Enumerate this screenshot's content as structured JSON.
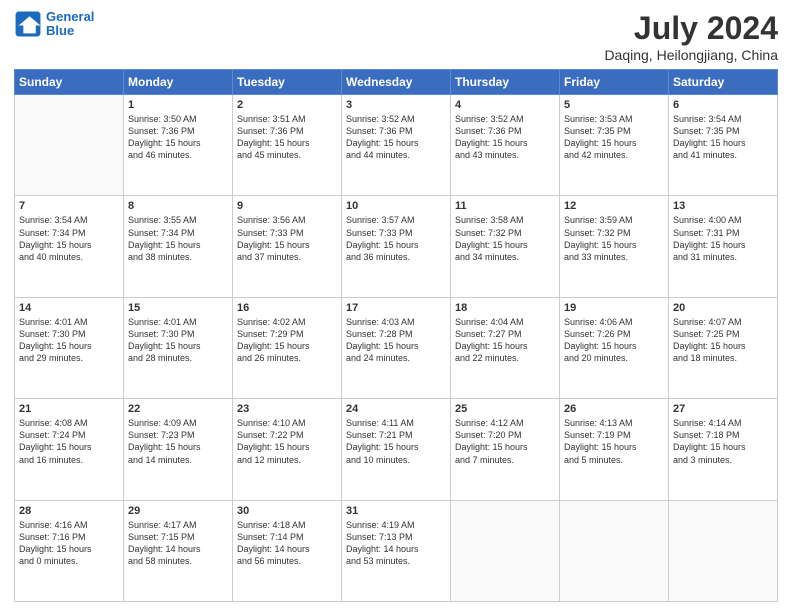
{
  "header": {
    "logo_line1": "General",
    "logo_line2": "Blue",
    "title": "July 2024",
    "subtitle": "Daqing, Heilongjiang, China"
  },
  "calendar": {
    "headers": [
      "Sunday",
      "Monday",
      "Tuesday",
      "Wednesday",
      "Thursday",
      "Friday",
      "Saturday"
    ],
    "rows": [
      [
        {
          "day": "",
          "info": ""
        },
        {
          "day": "1",
          "info": "Sunrise: 3:50 AM\nSunset: 7:36 PM\nDaylight: 15 hours\nand 46 minutes."
        },
        {
          "day": "2",
          "info": "Sunrise: 3:51 AM\nSunset: 7:36 PM\nDaylight: 15 hours\nand 45 minutes."
        },
        {
          "day": "3",
          "info": "Sunrise: 3:52 AM\nSunset: 7:36 PM\nDaylight: 15 hours\nand 44 minutes."
        },
        {
          "day": "4",
          "info": "Sunrise: 3:52 AM\nSunset: 7:36 PM\nDaylight: 15 hours\nand 43 minutes."
        },
        {
          "day": "5",
          "info": "Sunrise: 3:53 AM\nSunset: 7:35 PM\nDaylight: 15 hours\nand 42 minutes."
        },
        {
          "day": "6",
          "info": "Sunrise: 3:54 AM\nSunset: 7:35 PM\nDaylight: 15 hours\nand 41 minutes."
        }
      ],
      [
        {
          "day": "7",
          "info": "Sunrise: 3:54 AM\nSunset: 7:34 PM\nDaylight: 15 hours\nand 40 minutes."
        },
        {
          "day": "8",
          "info": "Sunrise: 3:55 AM\nSunset: 7:34 PM\nDaylight: 15 hours\nand 38 minutes."
        },
        {
          "day": "9",
          "info": "Sunrise: 3:56 AM\nSunset: 7:33 PM\nDaylight: 15 hours\nand 37 minutes."
        },
        {
          "day": "10",
          "info": "Sunrise: 3:57 AM\nSunset: 7:33 PM\nDaylight: 15 hours\nand 36 minutes."
        },
        {
          "day": "11",
          "info": "Sunrise: 3:58 AM\nSunset: 7:32 PM\nDaylight: 15 hours\nand 34 minutes."
        },
        {
          "day": "12",
          "info": "Sunrise: 3:59 AM\nSunset: 7:32 PM\nDaylight: 15 hours\nand 33 minutes."
        },
        {
          "day": "13",
          "info": "Sunrise: 4:00 AM\nSunset: 7:31 PM\nDaylight: 15 hours\nand 31 minutes."
        }
      ],
      [
        {
          "day": "14",
          "info": "Sunrise: 4:01 AM\nSunset: 7:30 PM\nDaylight: 15 hours\nand 29 minutes."
        },
        {
          "day": "15",
          "info": "Sunrise: 4:01 AM\nSunset: 7:30 PM\nDaylight: 15 hours\nand 28 minutes."
        },
        {
          "day": "16",
          "info": "Sunrise: 4:02 AM\nSunset: 7:29 PM\nDaylight: 15 hours\nand 26 minutes."
        },
        {
          "day": "17",
          "info": "Sunrise: 4:03 AM\nSunset: 7:28 PM\nDaylight: 15 hours\nand 24 minutes."
        },
        {
          "day": "18",
          "info": "Sunrise: 4:04 AM\nSunset: 7:27 PM\nDaylight: 15 hours\nand 22 minutes."
        },
        {
          "day": "19",
          "info": "Sunrise: 4:06 AM\nSunset: 7:26 PM\nDaylight: 15 hours\nand 20 minutes."
        },
        {
          "day": "20",
          "info": "Sunrise: 4:07 AM\nSunset: 7:25 PM\nDaylight: 15 hours\nand 18 minutes."
        }
      ],
      [
        {
          "day": "21",
          "info": "Sunrise: 4:08 AM\nSunset: 7:24 PM\nDaylight: 15 hours\nand 16 minutes."
        },
        {
          "day": "22",
          "info": "Sunrise: 4:09 AM\nSunset: 7:23 PM\nDaylight: 15 hours\nand 14 minutes."
        },
        {
          "day": "23",
          "info": "Sunrise: 4:10 AM\nSunset: 7:22 PM\nDaylight: 15 hours\nand 12 minutes."
        },
        {
          "day": "24",
          "info": "Sunrise: 4:11 AM\nSunset: 7:21 PM\nDaylight: 15 hours\nand 10 minutes."
        },
        {
          "day": "25",
          "info": "Sunrise: 4:12 AM\nSunset: 7:20 PM\nDaylight: 15 hours\nand 7 minutes."
        },
        {
          "day": "26",
          "info": "Sunrise: 4:13 AM\nSunset: 7:19 PM\nDaylight: 15 hours\nand 5 minutes."
        },
        {
          "day": "27",
          "info": "Sunrise: 4:14 AM\nSunset: 7:18 PM\nDaylight: 15 hours\nand 3 minutes."
        }
      ],
      [
        {
          "day": "28",
          "info": "Sunrise: 4:16 AM\nSunset: 7:16 PM\nDaylight: 15 hours\nand 0 minutes."
        },
        {
          "day": "29",
          "info": "Sunrise: 4:17 AM\nSunset: 7:15 PM\nDaylight: 14 hours\nand 58 minutes."
        },
        {
          "day": "30",
          "info": "Sunrise: 4:18 AM\nSunset: 7:14 PM\nDaylight: 14 hours\nand 56 minutes."
        },
        {
          "day": "31",
          "info": "Sunrise: 4:19 AM\nSunset: 7:13 PM\nDaylight: 14 hours\nand 53 minutes."
        },
        {
          "day": "",
          "info": ""
        },
        {
          "day": "",
          "info": ""
        },
        {
          "day": "",
          "info": ""
        }
      ]
    ]
  }
}
